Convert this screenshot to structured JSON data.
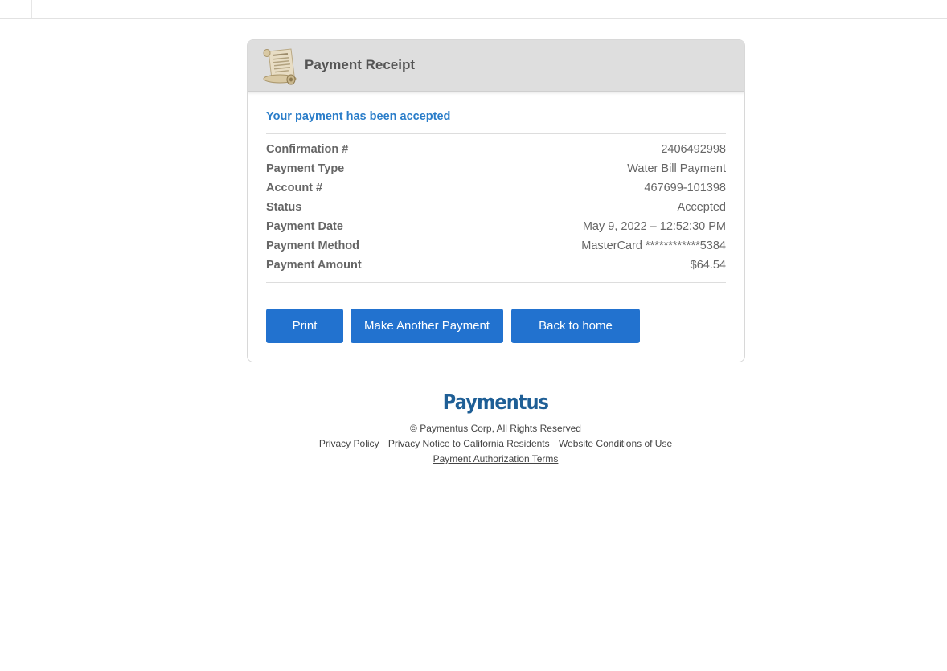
{
  "header": {
    "title": "Payment Receipt",
    "icon": "receipt-scroll-icon"
  },
  "receipt": {
    "message": "Your payment has been accepted",
    "rows": [
      {
        "label": "Confirmation #",
        "value": "2406492998"
      },
      {
        "label": "Payment Type",
        "value": "Water Bill Payment"
      },
      {
        "label": "Account #",
        "value": "467699-101398"
      },
      {
        "label": "Status",
        "value": "Accepted"
      },
      {
        "label": "Payment Date",
        "value": "May 9, 2022 – 12:52:30 PM"
      },
      {
        "label": "Payment Method",
        "value": "MasterCard ************5384"
      },
      {
        "label": "Payment Amount",
        "value": "$64.54"
      }
    ]
  },
  "actions": {
    "print_label": "Print",
    "another_label": "Make Another Payment",
    "home_label": "Back to home"
  },
  "footer": {
    "logo": "Paymentus",
    "copyright": "© Paymentus Corp, All Rights Reserved",
    "links": {
      "privacy_policy": "Privacy Policy",
      "privacy_notice": "Privacy Notice to California Residents",
      "conditions": "Website Conditions of Use",
      "authorization": "Payment Authorization Terms"
    }
  },
  "colors": {
    "accent_blue": "#2272cf",
    "message_blue": "#2a7dc9",
    "logo_blue": "#1f5f96",
    "header_gray": "#dedede"
  }
}
